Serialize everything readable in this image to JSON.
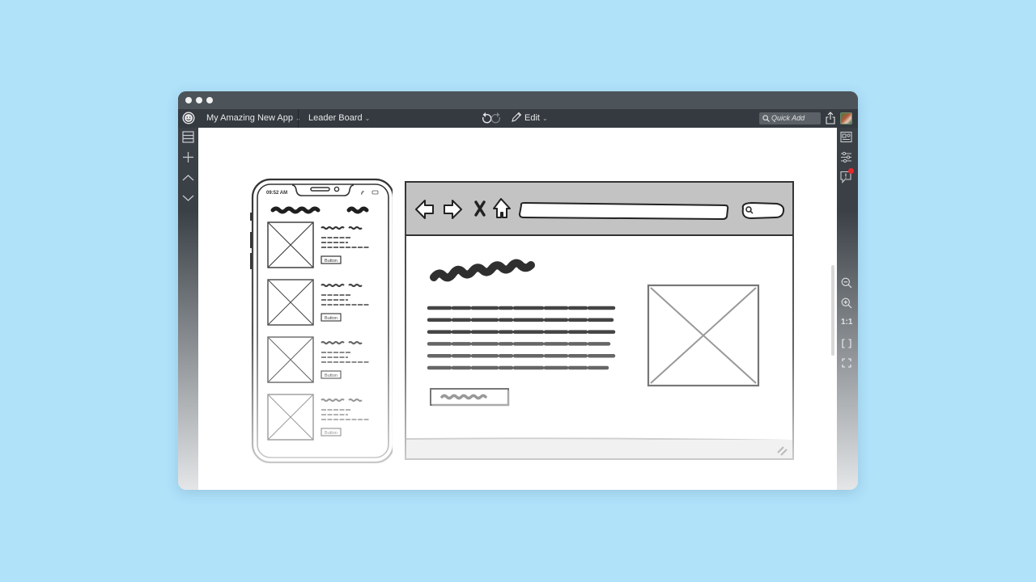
{
  "window": {
    "traffic_lights": [
      "close",
      "minimize",
      "maximize"
    ]
  },
  "toolbar": {
    "logo_icon": "smiley-logo-icon",
    "project_name": "My Amazing New App",
    "page_name": "Leader Board",
    "undo_icon": "undo-icon",
    "redo_icon": "redo-icon",
    "edit_label": "Edit",
    "quick_add_placeholder": "Quick Add",
    "share_icon": "share-icon",
    "avatar_icon": "user-avatar"
  },
  "left_sidebar": {
    "items": [
      {
        "icon": "list-panel-icon",
        "label": "Pages"
      },
      {
        "icon": "plus-icon",
        "label": "Add page"
      },
      {
        "icon": "chevron-up-icon",
        "label": "Previous page"
      },
      {
        "icon": "chevron-down-icon",
        "label": "Next page"
      }
    ]
  },
  "right_sidebar": {
    "top_items": [
      {
        "icon": "component-panel-icon",
        "label": "Components"
      },
      {
        "icon": "sliders-icon",
        "label": "Properties"
      },
      {
        "icon": "comment-icon",
        "label": "Comments",
        "badge": true,
        "badge_color": "#e8282b"
      }
    ],
    "zoom_items": [
      {
        "icon": "zoom-out-icon",
        "label": "Zoom out"
      },
      {
        "icon": "zoom-in-icon",
        "label": "Zoom in"
      },
      {
        "icon": "actual-size",
        "label": "1:1"
      },
      {
        "icon": "fit-width-icon",
        "label": "Fit width"
      },
      {
        "icon": "fit-page-icon",
        "label": "Fit page"
      }
    ]
  },
  "mockup": {
    "phone": {
      "status_time": "09:52 AM",
      "cards": [
        {
          "button_label": "Button"
        },
        {
          "button_label": "Button"
        },
        {
          "button_label": "Button"
        },
        {
          "button_label": "Button"
        }
      ]
    },
    "browser": {
      "nav_icons": [
        "back-arrow-icon",
        "forward-arrow-icon",
        "stop-x-icon",
        "home-icon"
      ],
      "search_icon": "search-icon",
      "body_lines": 6
    }
  },
  "colors": {
    "background": "#b0e2fa",
    "toolbar": "#343a40",
    "titlebar": "#4d5459",
    "badge": "#e8282b"
  }
}
